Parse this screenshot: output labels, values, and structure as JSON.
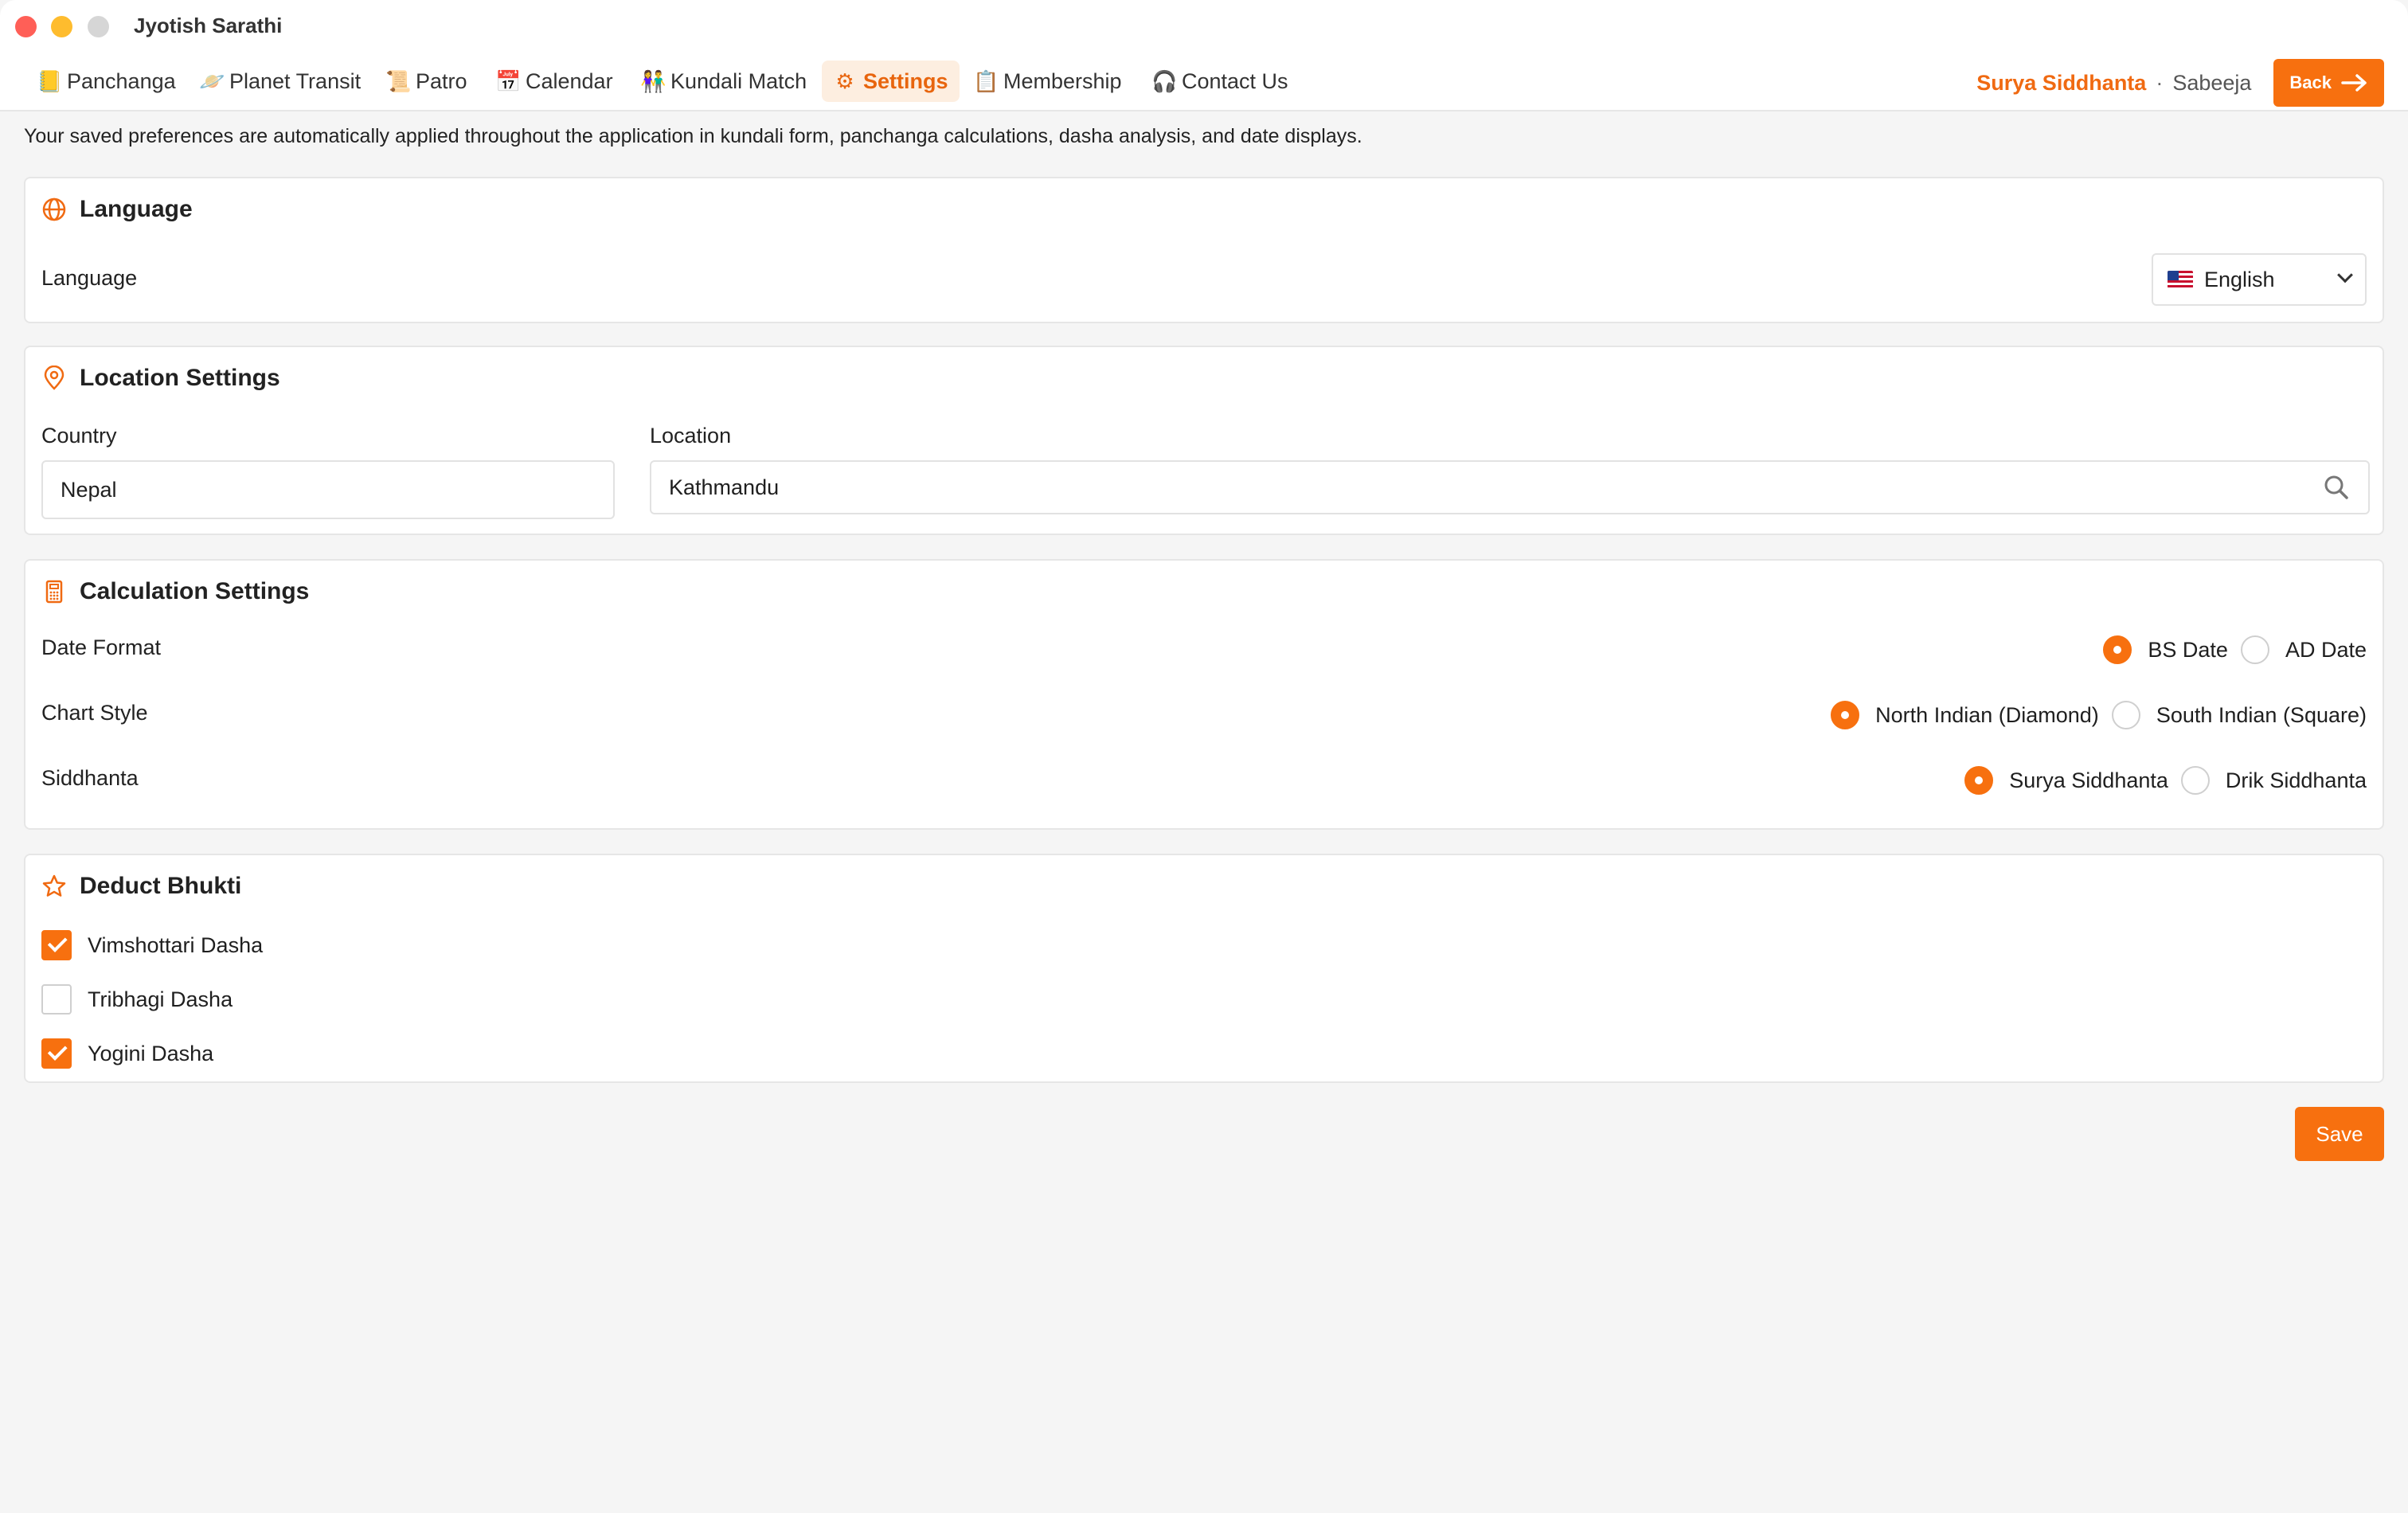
{
  "window": {
    "title": "Jyotish Sarathi"
  },
  "nav": {
    "items": [
      {
        "label": "Panchanga",
        "icon": "📒",
        "name": "nav-panchanga"
      },
      {
        "label": "Planet Transit",
        "icon": "🪐",
        "name": "nav-planet-transit"
      },
      {
        "label": "Patro",
        "icon": "📜",
        "name": "nav-patro"
      },
      {
        "label": "Calendar",
        "icon": "📅",
        "name": "nav-calendar"
      },
      {
        "label": "Kundali Match",
        "icon": "👫",
        "name": "nav-kundali-match"
      },
      {
        "label": "Settings",
        "icon": "⚙",
        "name": "nav-settings",
        "active": true
      },
      {
        "label": "Membership",
        "icon": "📋",
        "name": "nav-membership"
      },
      {
        "label": "Contact Us",
        "icon": "🎧",
        "name": "nav-contact-us"
      }
    ],
    "siddhanta": "Surya Siddhanta",
    "separator": "·",
    "mode": "Sabeeja",
    "back_label": "Back"
  },
  "intro_text": "Your saved preferences are automatically applied throughout the application in kundali form, panchanga calculations, dasha analysis, and date displays.",
  "language_card": {
    "title": "Language",
    "label": "Language",
    "selected": "English",
    "flag": "us-flag"
  },
  "location_card": {
    "title": "Location Settings",
    "country_label": "Country",
    "country_value": "Nepal",
    "location_label": "Location",
    "location_value": "Kathmandu"
  },
  "calculation_card": {
    "title": "Calculation Settings",
    "date_format": {
      "label": "Date Format",
      "options": [
        "BS Date",
        "AD Date"
      ],
      "selected": 0
    },
    "chart_style": {
      "label": "Chart Style",
      "options": [
        "North Indian (Diamond)",
        "South Indian (Square)"
      ],
      "selected": 0
    },
    "siddhanta": {
      "label": "Siddhanta",
      "options": [
        "Surya Siddhanta",
        "Drik Siddhanta"
      ],
      "selected": 0
    }
  },
  "bhukti_card": {
    "title": "Deduct Bhukti",
    "items": [
      {
        "label": "Vimshottari Dasha",
        "checked": true
      },
      {
        "label": "Tribhagi Dasha",
        "checked": false
      },
      {
        "label": "Yogini Dasha",
        "checked": true
      }
    ]
  },
  "save_label": "Save",
  "colors": {
    "accent": "#f7700f",
    "accent_text": "#e8650e",
    "active_bg": "#fdeee0"
  }
}
